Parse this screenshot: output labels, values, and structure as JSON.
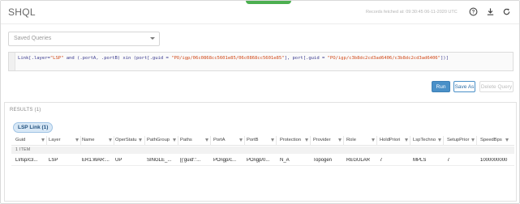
{
  "header": {
    "title": "SHQL",
    "fetch_time": "Records fetched at: 09:30:45 06-11-2020 UTC",
    "accent": "#4caf50",
    "icons": [
      "help-icon",
      "download-icon",
      "refresh-icon"
    ]
  },
  "saved_queries": {
    "placeholder": "Saved Queries"
  },
  "editor": {
    "part1": "Link[.layer=",
    "str1": "\"LSP\"",
    "part2": " and (.portA, .portB) xin (port[.guid = ",
    "str2": "\"PO/igp/06c0868cc5601e85/06c0868cc5601e85\"",
    "part3": "], port[.guid = ",
    "str3": "\"PO/igp/c3b8dc2cd3ad6406/c3b8dc2cd3ad6406\"",
    "part4": "])]"
  },
  "actions": {
    "run": "Run",
    "save_as": "Save As",
    "delete_query": "Delete Query",
    "primary_color": "#4a90c8"
  },
  "results": {
    "title": "RESULTS (1)",
    "tab_label": "LSP Link (1)",
    "group_label": "1 ITEM",
    "columns": [
      "Guid",
      "Layer",
      "Name",
      "OperStatu",
      "PathGroup",
      "Paths",
      "PortA",
      "PortB",
      "Protection",
      "Provider",
      "Role",
      "HoldPriori",
      "LspTechno",
      "SetupPrior",
      "SpeedBps"
    ],
    "rows": [
      [
        "LI/lsp/c3...",
        "LSP",
        "ER1.WAR:...",
        "UP",
        "SINGLE_...",
        "[{'guid':'...",
        "PO/igp/c...",
        "PO/igp/0...",
        "N_A",
        "Topogen",
        "REGULAR",
        "7",
        "MPLS",
        "7",
        "1000000000"
      ]
    ]
  }
}
